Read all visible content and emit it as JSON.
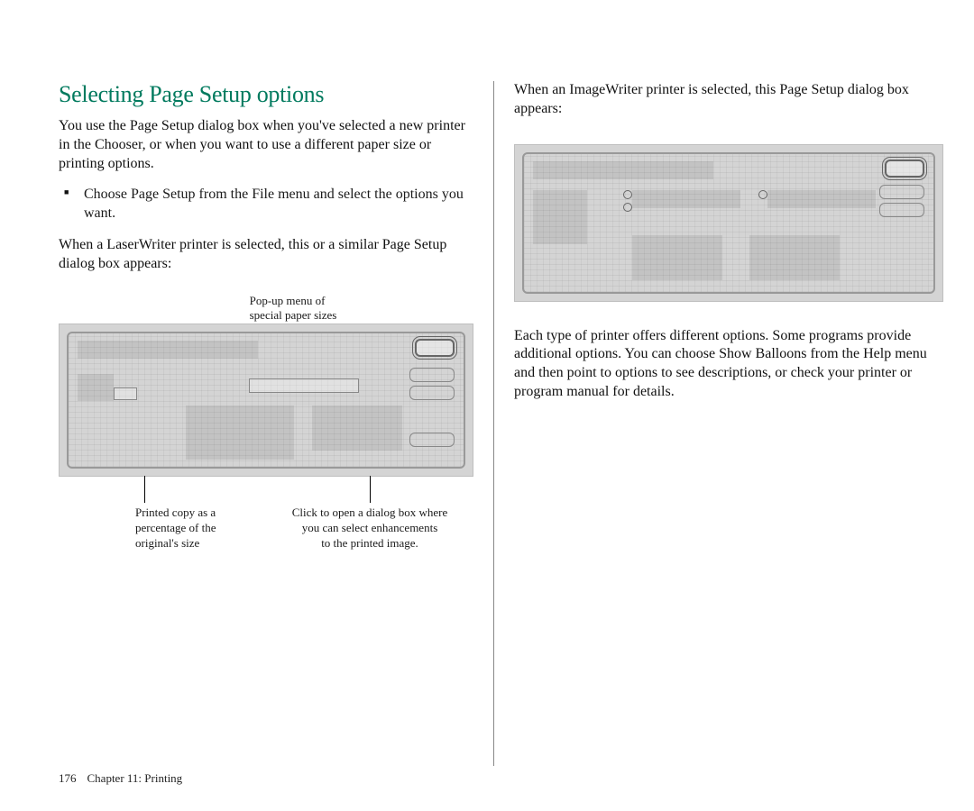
{
  "heading": "Selecting Page Setup options",
  "left": {
    "intro": "You use the Page Setup dialog box when you've selected a new printer in the Chooser, or when you want to use a different paper size or printing options.",
    "bullet": "Choose Page Setup from the File menu and select the options you want.",
    "afterBullet": "When a LaserWriter printer is selected, this or a similar Page Setup dialog box appears:",
    "topCaption": "Pop-up menu of\nspecial paper sizes",
    "captionLeft": "Printed copy as a\npercentage of the\noriginal's size",
    "captionRight": "Click to open a dialog box where\nyou can select enhancements\nto the printed image."
  },
  "right": {
    "intro": "When an ImageWriter printer is selected, this Page Setup dialog box appears:",
    "after": "Each type of printer offers different options. Some programs provide additional options. You can choose Show Balloons from the Help menu and then point to options to see descriptions, or check your printer or program manual for details."
  },
  "footer": {
    "pageNum": "176",
    "chapter": "Chapter 11: Printing"
  }
}
